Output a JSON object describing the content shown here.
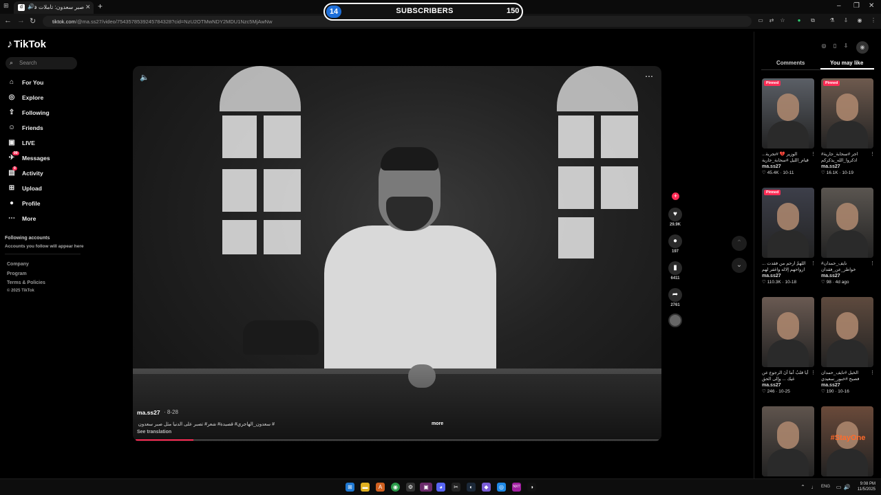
{
  "browser": {
    "tab_title": "صبر سعدون: تأملات في الح...",
    "tab_favicon": "d",
    "tab_close": "✕",
    "new_tab": "+",
    "url_host": "tiktok.com",
    "url_path": "/@ma.ss27/video/7543578539245784328?cid=NzU2OTMwNDY2MDU1Nzc5MjAwNw",
    "win_min": "–",
    "win_max": "❐",
    "win_close": "✕"
  },
  "overlay": {
    "current": "14",
    "label": "SUBSCRIBERS",
    "goal": "150"
  },
  "sidebar": {
    "logo": "TikTok",
    "search_placeholder": "Search",
    "items": [
      {
        "label": "For You",
        "icon": "⌂"
      },
      {
        "label": "Explore",
        "icon": "◎"
      },
      {
        "label": "Following",
        "icon": "⇪"
      },
      {
        "label": "Friends",
        "icon": "☺"
      },
      {
        "label": "LIVE",
        "icon": "▣"
      },
      {
        "label": "Messages",
        "icon": "✈",
        "badge": "99"
      },
      {
        "label": "Activity",
        "icon": "▤",
        "badge": "9"
      },
      {
        "label": "Upload",
        "icon": "⊞"
      },
      {
        "label": "Profile",
        "icon": "●"
      },
      {
        "label": "More",
        "icon": "⋯"
      }
    ],
    "following_heading": "Following accounts",
    "following_desc": "Accounts you follow will appear here",
    "footer": [
      "Company",
      "Program",
      "Terms & Policies",
      "© 2025 TikTok"
    ]
  },
  "video": {
    "author": "ma.ss27",
    "date": "· 8-28",
    "caption": "# سعدون_الهاجري# قصيدة# شعر# تصبر على الدنيا مثل صبر سعدون",
    "caption_more": "more",
    "see_translation": "See translation",
    "progress": 0.11
  },
  "actions": {
    "likes": "29.9K",
    "comments": "197",
    "saves": "6411",
    "shares": "2761"
  },
  "right_panel": {
    "tab_comments": "Comments",
    "tab_you_may_like": "You may like",
    "cards": [
      {
        "pinned": "Pinned",
        "thumb_text": "",
        "desc": "الوزير 💔 #تجربة... قيام_الليل #سحابة_جارية",
        "author": "ma.ss27",
        "meta": "♡ 45.4K · 10-11",
        "bg": "#5b5f66"
      },
      {
        "pinned": "Pinned",
        "thumb_text": "",
        "desc": "اجر #سحابة_جارية# اذكروا_الله_يذكركم",
        "author": "ma.ss27",
        "meta": "♡ 16.1K · 10-19",
        "bg": "#6e5a4e"
      },
      {
        "pinned": "Pinned",
        "thumb_text": "",
        "desc": "اللهمّ ارحم من فقدت ... ارواحهم إلاله واغفر لهم",
        "author": "ma.ss27",
        "meta": "♡ 110.3K · 10-18",
        "bg": "#3d3f4a"
      },
      {
        "pinned": "",
        "thumb_text": "",
        "desc": "نايف_حمدان# خواطر_عن_فقدان",
        "author": "ma.ss27",
        "meta": "♡ 98 · 4d ago",
        "bg": "#5a5550"
      },
      {
        "pinned": "",
        "thumb_text": "",
        "desc": "أيا قلبُ أما آنَ الرجوع عن غيك ... وإلى الحق",
        "author": "ma.ss27",
        "meta": "♡ 246 · 10-25",
        "bg": "#6a5a52"
      },
      {
        "pinned": "",
        "thumb_text": "",
        "desc": "الخيل #نايف_حمدان فصيح #خبور_سعيدي",
        "author": "ma.ss27",
        "meta": "♡ 190 · 10-16",
        "bg": "#5e4a3e"
      },
      {
        "pinned": "",
        "thumb_text": "",
        "desc": "",
        "author": "",
        "meta": "",
        "bg": "#5f544d"
      },
      {
        "pinned": "",
        "thumb_text": "#StayOne",
        "desc": "",
        "author": "",
        "meta": "",
        "bg": "#6a4a3a"
      }
    ]
  },
  "taskbar": {
    "lang": "ENG",
    "time": "9:08 PM",
    "date": "11/5/2025"
  },
  "colors": {
    "accent": "#fe2c55",
    "overlay_blue": "#1e6fd9",
    "background": "#000000"
  }
}
